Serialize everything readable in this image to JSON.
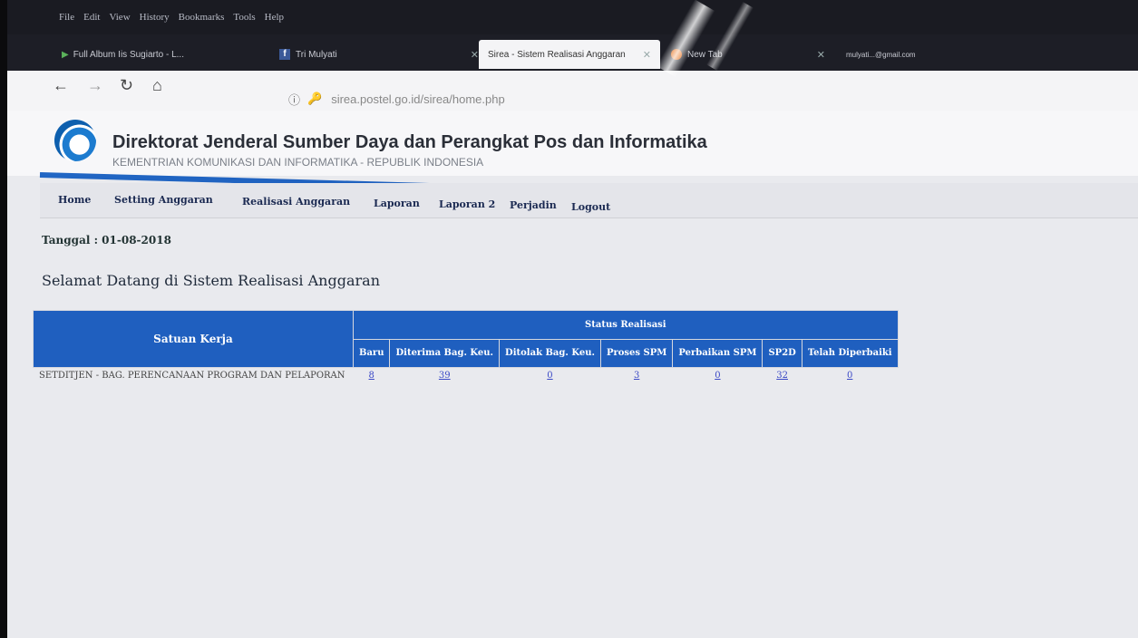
{
  "browser": {
    "menu": [
      "File",
      "Edit",
      "View",
      "History",
      "Bookmarks",
      "Tools",
      "Help"
    ],
    "tabs": [
      {
        "label": "Full Album Iis Sugiarto - L...",
        "icon": "play-icon"
      },
      {
        "label": "Tri Mulyati",
        "icon": "facebook-icon"
      },
      {
        "label": "Sirea - Sistem Realisasi Anggaran",
        "icon": "none"
      },
      {
        "label": "New Tab",
        "icon": "firefox-icon"
      },
      {
        "label": "mulyati...@gmail.com"
      }
    ],
    "url": "sirea.postel.go.id/sirea/home.php"
  },
  "header": {
    "title": "Direktorat Jenderal Sumber Daya dan Perangkat Pos dan Informatika",
    "subtitle": "KEMENTRIAN KOMUNIKASI DAN INFORMATIKA - REPUBLIK INDONESIA"
  },
  "menu": [
    "Home",
    "Setting Anggaran",
    "Realisasi Anggaran",
    "Laporan",
    "Laporan 2",
    "Perjadin",
    "Logout"
  ],
  "date": "Tanggal : 01-08-2018",
  "welcome": "Selamat Datang di Sistem Realisasi Anggaran",
  "table": {
    "col_satker": "Satuan Kerja",
    "group_header": "Status Realisasi",
    "columns": [
      "Baru",
      "Diterima Bag. Keu.",
      "Ditolak Bag. Keu.",
      "Proses SPM",
      "Perbaikan SPM",
      "SP2D",
      "Telah Diperbaiki"
    ],
    "rows": [
      {
        "satker": "SETDITJEN - BAG. PERENCANAAN PROGRAM DAN PELAPORAN",
        "values": [
          "8",
          "39",
          "0",
          "3",
          "0",
          "32",
          "0"
        ]
      }
    ]
  }
}
